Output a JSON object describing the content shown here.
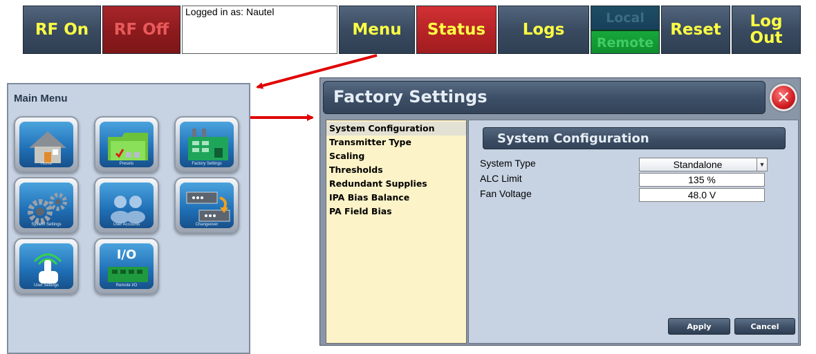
{
  "toolbar": {
    "rf_on": "RF On",
    "rf_off": "RF Off",
    "login_text": "Logged in as: Nautel",
    "menu": "Menu",
    "status": "Status",
    "logs": "Logs",
    "local": "Local",
    "remote": "Remote",
    "reset": "Reset",
    "logout_line1": "Log",
    "logout_line2": "Out"
  },
  "main_menu": {
    "title": "Main Menu",
    "tiles": [
      {
        "label": "Home",
        "icon": "home-icon"
      },
      {
        "label": "Presets",
        "icon": "folder-icon"
      },
      {
        "label": "Factory Settings",
        "icon": "factory-icon"
      },
      {
        "label": "System Settings",
        "icon": "gears-icon"
      },
      {
        "label": "User Accounts",
        "icon": "users-icon"
      },
      {
        "label": "Changeover",
        "icon": "changeover-icon"
      },
      {
        "label": "User Settings",
        "icon": "touch-icon"
      },
      {
        "label": "Remote I/O",
        "icon": "io-board-icon",
        "text": "I/O"
      }
    ]
  },
  "factory_settings": {
    "title": "Factory Settings",
    "list_items": [
      "System Configuration",
      "Transmitter Type",
      "Scaling",
      "Thresholds",
      "Redundant Supplies",
      "IPA Bias Balance",
      "PA Field Bias"
    ],
    "selected_index": 0,
    "section_title": "System Configuration",
    "fields": {
      "system_type": {
        "label": "System Type",
        "value": "Standalone"
      },
      "alc_limit": {
        "label": "ALC Limit",
        "value": "135 %"
      },
      "fan_voltage": {
        "label": "Fan Voltage",
        "value": "48.0 V"
      }
    },
    "apply": "Apply",
    "cancel": "Cancel"
  },
  "colors": {
    "button_blue": "#3a4b61",
    "button_red": "#b62326",
    "status_yellow": "#ffff44",
    "remote_green": "#17a73a",
    "panel_bg": "#c7d3e3",
    "list_bg": "#fdf3c8",
    "arrow_red": "#e00000"
  }
}
